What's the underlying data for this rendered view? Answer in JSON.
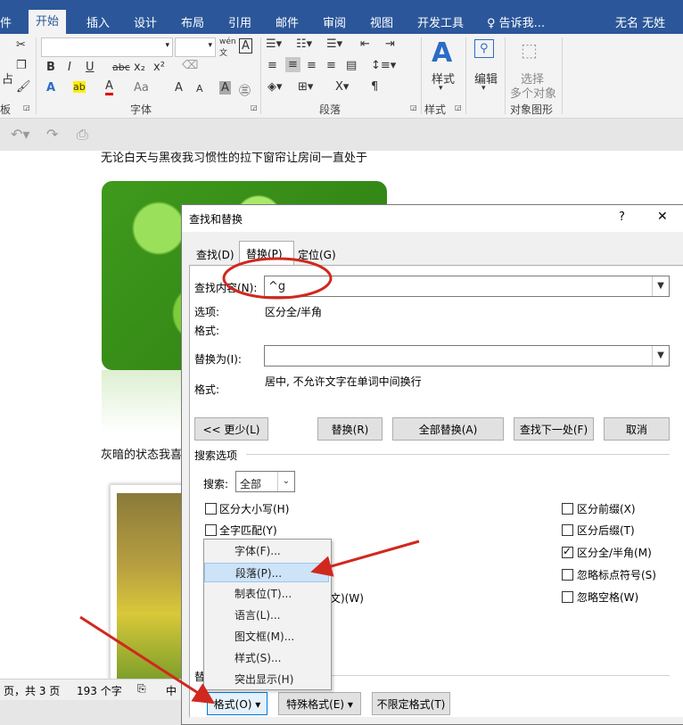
{
  "tabs": {
    "file": "件",
    "home": "开始",
    "insert": "插入",
    "design": "设计",
    "layout": "布局",
    "references": "引用",
    "mailings": "邮件",
    "review": "审阅",
    "view": "视图",
    "developer": "开发工具",
    "tell_me": "告诉我...",
    "user": "无名 无姓"
  },
  "ribbon": {
    "clipboard_partial": "板",
    "paste_partial": "占",
    "font_group": "字体",
    "paragraph_group": "段落",
    "styles_btn": "样式",
    "styles_group": "样式",
    "edit_btn": "编辑",
    "select_btn_line1": "选择",
    "select_btn_line2": "多个对象",
    "select_group": "对象图形",
    "wen": "wén",
    "wen_char": "文",
    "A_box": "A",
    "bold": "B",
    "italic": "I",
    "underline": "U",
    "strike": "abc",
    "sub": "x₂",
    "sup": "x²",
    "font_a": "A",
    "highlight": "ab",
    "font_color": "A",
    "aa": "Aa",
    "grow": "A",
    "shrink": "A",
    "char_shading": "A",
    "phonetic": "㊂"
  },
  "document": {
    "line1": "无论白天与黑夜我习惯性的拉下窗帘让房间一直处于",
    "line2": "灰暗的状态我喜"
  },
  "status": {
    "pages": "页，共 3 页",
    "words": "193 个字",
    "lang": "中"
  },
  "dialog": {
    "title": "查找和替换",
    "help": "?",
    "close": "✕",
    "tabs": [
      "查找(D)",
      "替换(P)",
      "定位(G)"
    ],
    "find_label": "查找内容(N):",
    "find_value": "^g",
    "options_label": "选项:",
    "options_value": "区分全/半角",
    "format_label": "格式:",
    "replace_label": "替换为(I):",
    "replace_value": "",
    "replace_format_label": "格式:",
    "replace_format_value": "居中, 不允许文字在单词中间换行",
    "buttons": {
      "less": "<< 更少(L)",
      "replace": "替换(R)",
      "replace_all": "全部替换(A)",
      "find_next": "查找下一处(F)",
      "cancel": "取消"
    },
    "search_options": "搜索选项",
    "search_label": "搜索:",
    "search_value": "全部",
    "left_options": [
      {
        "label": "区分大小写(H)",
        "checked": false
      },
      {
        "label": "全字匹配(Y)",
        "checked": false
      }
    ],
    "hidden_suffix": "文)(W)",
    "right_options": [
      {
        "label": "区分前缀(X)",
        "checked": false
      },
      {
        "label": "区分后缀(T)",
        "checked": false
      },
      {
        "label": "区分全/半角(M)",
        "checked": true
      },
      {
        "label": "忽略标点符号(S)",
        "checked": false
      },
      {
        "label": "忽略空格(W)",
        "checked": false
      }
    ],
    "replace_section_partial": "替",
    "bottom_buttons": {
      "format": "格式(O) ▾",
      "special": "特殊格式(E) ▾",
      "no_format": "不限定格式(T)"
    }
  },
  "format_menu": [
    "字体(F)...",
    "段落(P)...",
    "制表位(T)...",
    "语言(L)...",
    "图文框(M)...",
    "样式(S)...",
    "突出显示(H)"
  ],
  "colors": {
    "ribbon_blue": "#2b579a",
    "annotation_red": "#d0281e",
    "highlight": "#cde3f7"
  }
}
